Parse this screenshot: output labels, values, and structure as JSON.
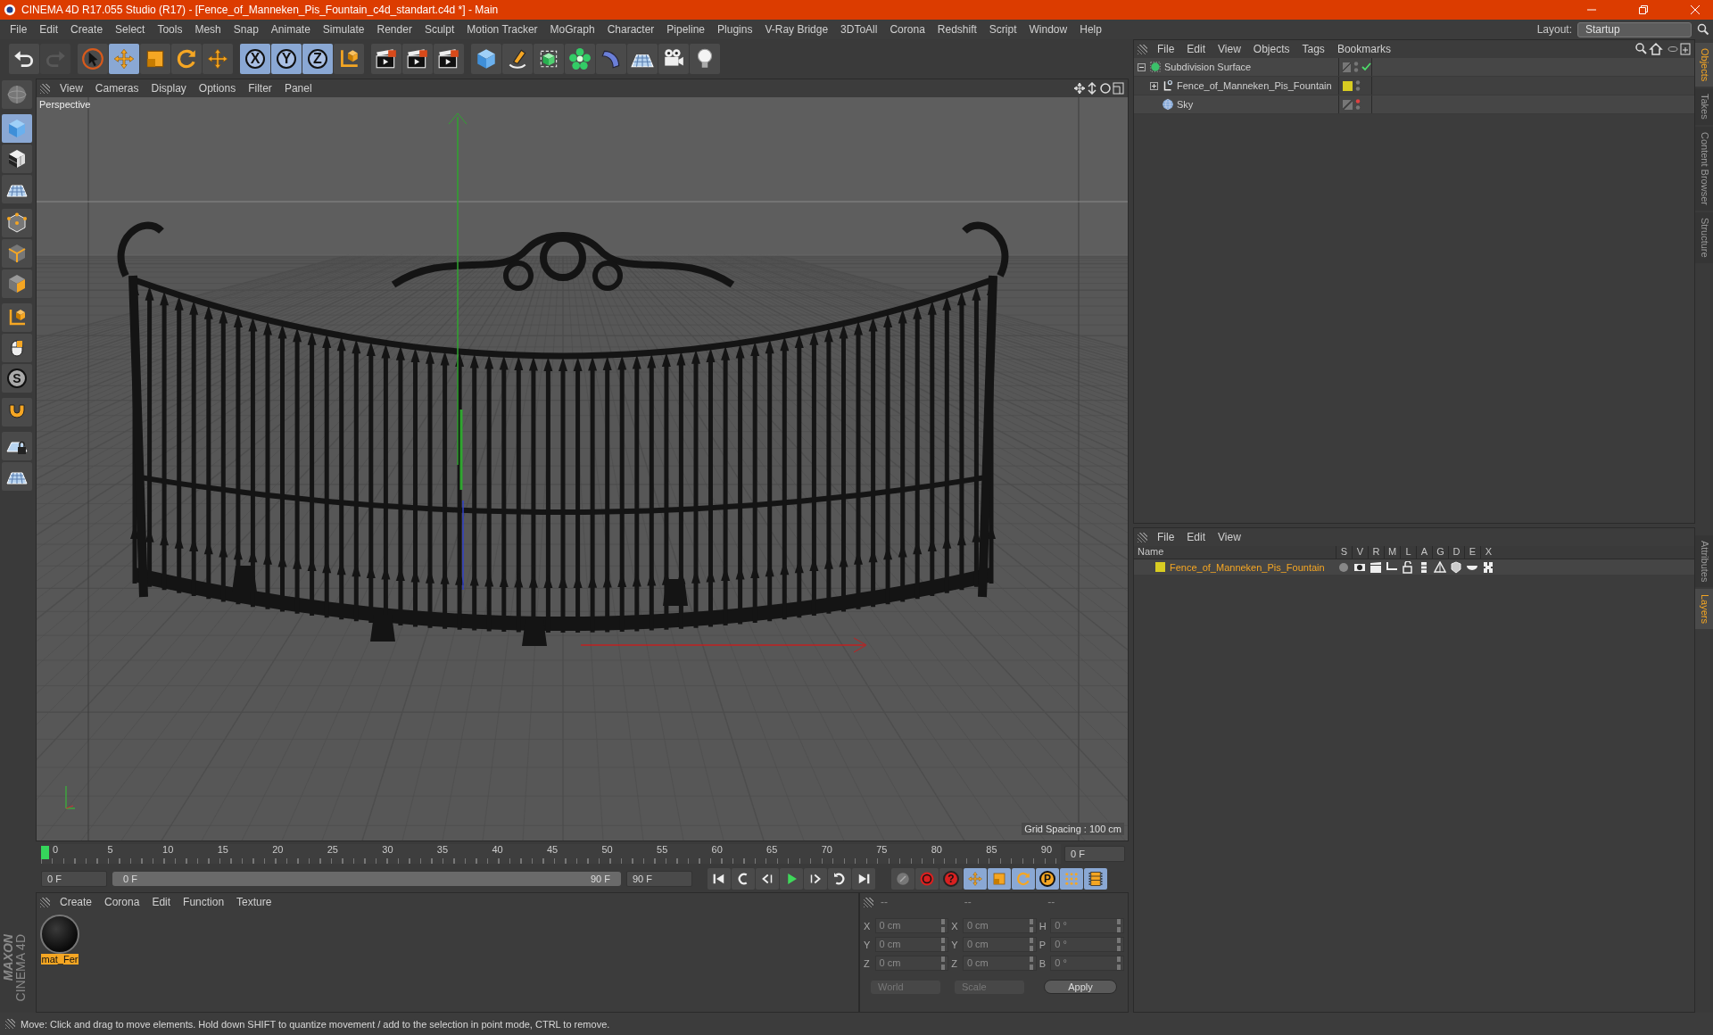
{
  "window": {
    "title": "CINEMA 4D R17.055 Studio (R17) - [Fence_of_Manneken_Pis_Fountain_c4d_standart.c4d *] - Main"
  },
  "menu": [
    "File",
    "Edit",
    "Create",
    "Select",
    "Tools",
    "Mesh",
    "Snap",
    "Animate",
    "Simulate",
    "Render",
    "Sculpt",
    "Motion Tracker",
    "MoGraph",
    "Character",
    "Pipeline",
    "Plugins",
    "V-Ray Bridge",
    "3DToAll",
    "Corona",
    "Redshift",
    "Script",
    "Window",
    "Help"
  ],
  "layout": {
    "label": "Layout:",
    "value": "Startup"
  },
  "toolbar": [
    [
      {
        "kind": "undo",
        "selected": false,
        "disabled": false
      },
      {
        "kind": "redo",
        "selected": false,
        "disabled": true
      }
    ],
    [
      {
        "kind": "select",
        "selected": false,
        "disabled": false
      },
      {
        "kind": "move",
        "selected": true,
        "disabled": false
      },
      {
        "kind": "scale",
        "selected": false,
        "disabled": false
      },
      {
        "kind": "rotate",
        "selected": false,
        "disabled": false
      },
      {
        "kind": "move",
        "selected": false,
        "disabled": false
      }
    ],
    [
      {
        "kind": "axis",
        "label": "X",
        "selected": true,
        "disabled": false
      },
      {
        "kind": "axis",
        "label": "Y",
        "selected": true,
        "disabled": false
      },
      {
        "kind": "axis",
        "label": "Z",
        "selected": true,
        "disabled": false
      },
      {
        "kind": "coords",
        "selected": false,
        "disabled": false
      }
    ],
    [
      {
        "kind": "clapper",
        "selected": false,
        "disabled": false
      },
      {
        "kind": "clapper",
        "selected": false,
        "disabled": false
      },
      {
        "kind": "clapper",
        "selected": false,
        "disabled": false
      }
    ],
    [
      {
        "kind": "cube",
        "selected": false,
        "disabled": false
      },
      {
        "kind": "pen",
        "selected": false,
        "disabled": false
      },
      {
        "kind": "subdiv",
        "selected": false,
        "disabled": false
      },
      {
        "kind": "cloner",
        "selected": false,
        "disabled": false
      },
      {
        "kind": "deformer",
        "selected": false,
        "disabled": false
      },
      {
        "kind": "floor",
        "selected": false,
        "disabled": false
      },
      {
        "kind": "camera",
        "selected": false,
        "disabled": false
      },
      {
        "kind": "light",
        "selected": false,
        "disabled": false
      }
    ]
  ],
  "left_tools": [
    [
      {
        "kind": "sphere",
        "selected": false
      }
    ],
    [
      {
        "kind": "cube",
        "selected": true
      },
      {
        "kind": "checker",
        "selected": false
      },
      {
        "kind": "floor",
        "selected": false
      }
    ],
    [
      {
        "kind": "points",
        "selected": false
      },
      {
        "kind": "edges",
        "selected": false
      },
      {
        "kind": "polygons",
        "selected": false
      }
    ],
    [
      {
        "kind": "coords",
        "selected": false
      },
      {
        "kind": "mouse",
        "selected": false
      },
      {
        "kind": "axis",
        "label": "S",
        "selected": false
      }
    ],
    [
      {
        "kind": "magnet",
        "selected": false
      }
    ],
    [
      {
        "kind": "lockgrid",
        "selected": false
      },
      {
        "kind": "floor",
        "selected": false
      }
    ]
  ],
  "viewport": {
    "menu": [
      "View",
      "Cameras",
      "Display",
      "Options",
      "Filter",
      "Panel"
    ],
    "camera": "Perspective",
    "grid_spacing": "Grid Spacing : 100 cm"
  },
  "timeline": {
    "ticks": [
      "0",
      "5",
      "10",
      "15",
      "20",
      "25",
      "30",
      "35",
      "40",
      "45",
      "50",
      "55",
      "60",
      "65",
      "70",
      "75",
      "80",
      "85",
      "90"
    ],
    "level": 0,
    "current_frame": "0 F",
    "start": "0 F",
    "range": {
      "start": "0 F",
      "end": "90 F",
      "level": 1
    },
    "end": "90 F",
    "transport": [
      {
        "kind": "first",
        "selected": false
      },
      {
        "kind": "prevkey",
        "selected": false
      },
      {
        "kind": "prevframe",
        "selected": false
      },
      {
        "kind": "play",
        "selected": false
      },
      {
        "kind": "nextframe",
        "selected": false
      },
      {
        "kind": "nextkey",
        "selected": false
      },
      {
        "kind": "last",
        "selected": false
      }
    ],
    "keys": [
      {
        "kind": "record",
        "selected": false
      },
      {
        "kind": "autokey",
        "selected": false
      },
      {
        "kind": "keysel",
        "label": "?",
        "selected": false
      },
      {
        "kind": "move",
        "selected": true
      },
      {
        "kind": "scale",
        "selected": true
      },
      {
        "kind": "rotate",
        "selected": true
      },
      {
        "kind": "param",
        "label": "P",
        "selected": true
      },
      {
        "kind": "dots",
        "selected": true
      },
      {
        "kind": "film",
        "selected": true
      }
    ]
  },
  "materials": {
    "menu": [
      "Create",
      "Corona",
      "Edit",
      "Function",
      "Texture"
    ],
    "items": [
      {
        "name": "mat_Fer",
        "selected": true
      }
    ]
  },
  "coordinates": {
    "headers": [
      "--",
      "--",
      "--"
    ],
    "rows": [
      [
        {
          "label": "X",
          "value": "0 cm"
        },
        {
          "label": "X",
          "value": "0 cm"
        },
        {
          "label": "H",
          "value": "0 °"
        }
      ],
      [
        {
          "label": "Y",
          "value": "0 cm"
        },
        {
          "label": "Y",
          "value": "0 cm"
        },
        {
          "label": "P",
          "value": "0 °"
        }
      ],
      [
        {
          "label": "Z",
          "value": "0 cm"
        },
        {
          "label": "Z",
          "value": "0 cm"
        },
        {
          "label": "B",
          "value": "0 °"
        }
      ]
    ],
    "dropdowns": [
      "World",
      "Scale"
    ],
    "apply": "Apply"
  },
  "objects": {
    "menu": [
      "File",
      "Edit",
      "View",
      "Objects",
      "Tags",
      "Bookmarks"
    ],
    "tree": [
      {
        "name": "Subdivision Surface",
        "kind": "subdiv",
        "expanded": true,
        "enabled": true,
        "editor_off": false,
        "children": [
          {
            "name": "Fence_of_Manneken_Pis_Fountain",
            "kind": "null",
            "expanded": false,
            "enabled": false,
            "editor_off": false,
            "color": "#d8cc22"
          },
          {
            "name": "Sky",
            "kind": "sky",
            "enabled": false,
            "editor_off": true
          }
        ]
      }
    ]
  },
  "layers": {
    "menu": [
      "File",
      "Edit",
      "View"
    ],
    "columns": [
      {
        "label": "Name",
        "kind": "name"
      },
      {
        "label": "S",
        "kind": "solo"
      },
      {
        "label": "V",
        "kind": "view"
      },
      {
        "label": "R",
        "kind": "render"
      },
      {
        "label": "M",
        "kind": "manager"
      },
      {
        "label": "L",
        "kind": "lock"
      },
      {
        "label": "A",
        "kind": "anim"
      },
      {
        "label": "G",
        "kind": "gen"
      },
      {
        "label": "D",
        "kind": "deform"
      },
      {
        "label": "E",
        "kind": "expr"
      },
      {
        "label": "X",
        "kind": "xref"
      }
    ],
    "rows": [
      {
        "name": "Fence_of_Manneken_Pis_Fountain",
        "color": "#d8cc22"
      }
    ]
  },
  "side_tabs_top": [
    {
      "label": "Objects",
      "selected": true
    },
    {
      "label": "Takes",
      "selected": false
    },
    {
      "label": "Content Browser",
      "selected": false
    },
    {
      "label": "Structure",
      "selected": false
    }
  ],
  "side_tabs_bottom": [
    {
      "label": "Attributes",
      "selected": false
    },
    {
      "label": "Layers",
      "selected": true
    }
  ],
  "logo": [
    "MAXON",
    "CINEMA 4D"
  ],
  "status": "Move: Click and drag to move elements. Hold down SHIFT to quantize movement / add to the selection in point mode, CTRL to remove."
}
